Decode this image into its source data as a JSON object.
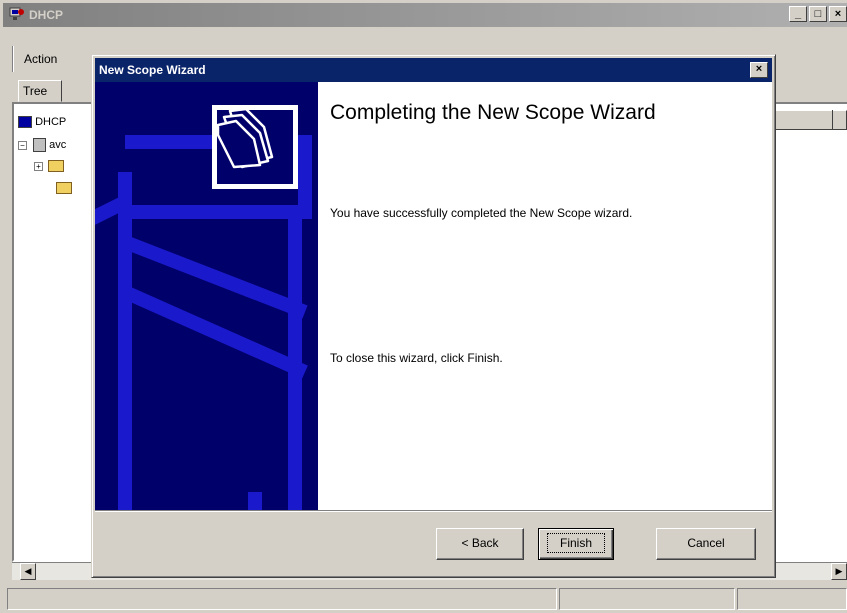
{
  "background_window": {
    "title": "DHCP",
    "menu_action": "Action",
    "tree_tab": "Tree",
    "tree_items": [
      "DHCP",
      "avc"
    ]
  },
  "dialog": {
    "title": "New Scope Wizard",
    "heading": "Completing the New Scope Wizard",
    "message_completed": "You have successfully completed the New Scope wizard.",
    "message_close": "To close this wizard, click Finish.",
    "buttons": {
      "back": "< Back",
      "finish": "Finish",
      "cancel": "Cancel"
    }
  },
  "colors": {
    "dialog_titlebar": "#0a246a",
    "banner": "#00006b",
    "banner_stripes": "#1a1acc",
    "face": "#d4d0c8"
  },
  "icons": {
    "window_icon": "dhcp-server-icon",
    "banner_icon": "folders-icon"
  }
}
